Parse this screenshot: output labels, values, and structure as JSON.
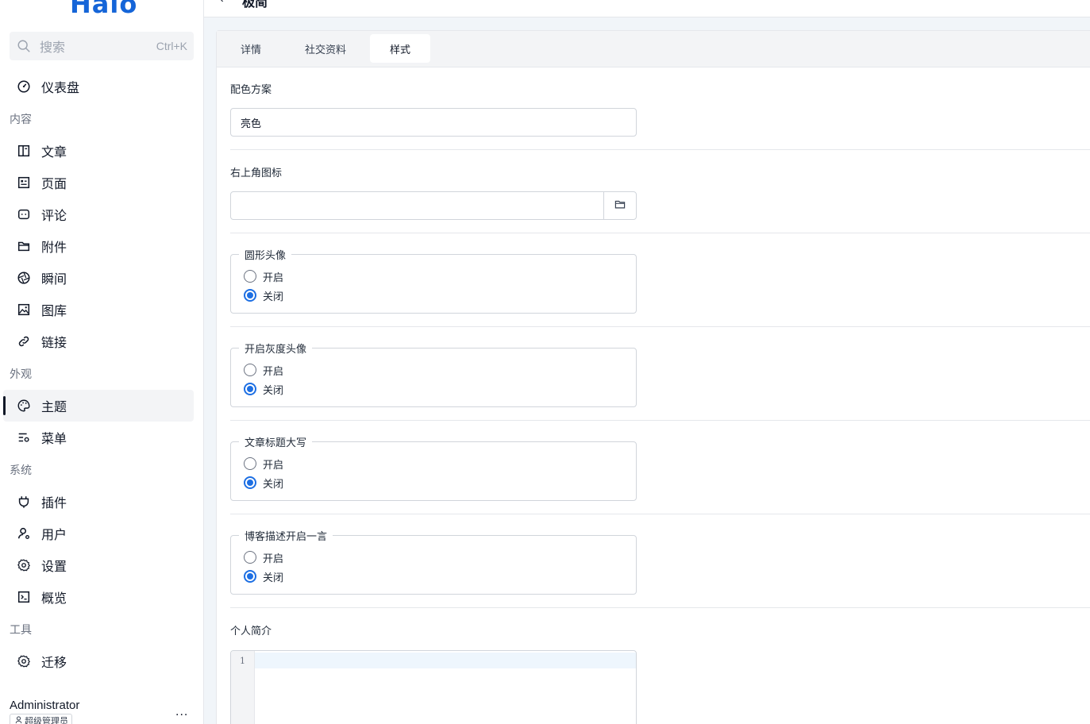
{
  "brand": {
    "logo": "Halo"
  },
  "search": {
    "placeholder": "搜索",
    "shortcut": "Ctrl+K"
  },
  "sidebar": {
    "dashboard": "仪表盘",
    "groups": {
      "content": "内容",
      "appearance": "外观",
      "system": "系统",
      "tools": "工具"
    },
    "items": {
      "posts": "文章",
      "pages": "页面",
      "comments": "评论",
      "attachments": "附件",
      "moments": "瞬间",
      "gallery": "图库",
      "links": "链接",
      "themes": "主题",
      "menus": "菜单",
      "plugins": "插件",
      "users": "用户",
      "settings": "设置",
      "overview": "概览",
      "migration": "迁移"
    },
    "active": "themes"
  },
  "user": {
    "name": "Administrator",
    "role": "超级管理员",
    "more": "..."
  },
  "header": {
    "back": "‹",
    "title": "极简"
  },
  "tabs": [
    "详情",
    "社交资料",
    "样式"
  ],
  "active_tab": "样式",
  "form": {
    "color_scheme": {
      "label": "配色方案",
      "value": "亮色"
    },
    "corner_icon": {
      "label": "右上角图标",
      "value": ""
    },
    "radio_groups": [
      {
        "legend": "圆形头像",
        "options": [
          "开启",
          "关闭"
        ],
        "selected": "关闭"
      },
      {
        "legend": "开启灰度头像",
        "options": [
          "开启",
          "关闭"
        ],
        "selected": "关闭"
      },
      {
        "legend": "文章标题大写",
        "options": [
          "开启",
          "关闭"
        ],
        "selected": "关闭"
      },
      {
        "legend": "博客描述开启一言",
        "options": [
          "开启",
          "关闭"
        ],
        "selected": "关闭"
      }
    ],
    "bio": {
      "label": "个人简介",
      "line_number": "1"
    }
  },
  "colors": {
    "accent": "#1d6fe3",
    "brand": "#1565d8"
  }
}
